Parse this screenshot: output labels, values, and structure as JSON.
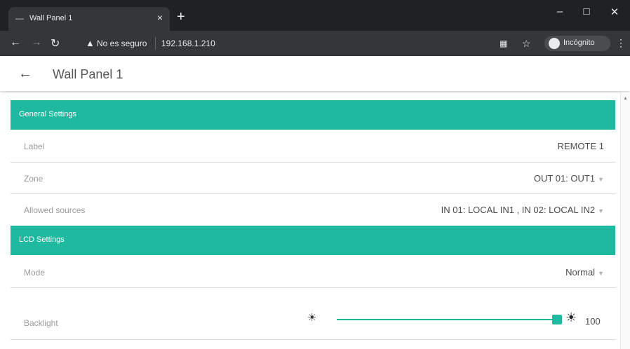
{
  "browser": {
    "tab_title": "Wall Panel 1",
    "security_warning": "No es seguro",
    "url": "192.168.1.210",
    "incognito_label": "Incógnito",
    "minimize": "–",
    "maximize": "□",
    "close": "✕"
  },
  "header": {
    "title": "Wall Panel 1"
  },
  "general": {
    "title": "General Settings",
    "rows": [
      {
        "label": "Label",
        "value": "REMOTE 1"
      },
      {
        "label": "Zone",
        "value": "OUT 01: OUT1"
      },
      {
        "label": "Allowed sources",
        "value": "IN 01: LOCAL IN1 , IN 02: LOCAL IN2"
      }
    ]
  },
  "lcd": {
    "title": "LCD Settings",
    "mode": {
      "label": "Mode",
      "value": "Normal"
    },
    "backlight": {
      "label": "Backlight",
      "value": "100"
    }
  },
  "colors": {
    "accent": "#1eb99f",
    "chrome_dark": "#202124",
    "chrome_toolbar": "#35363a"
  },
  "icons": {
    "back": "arrow-left-icon",
    "sun_small": "brightness-low-icon",
    "sun_large": "brightness-high-icon",
    "dropdown": "caret-down-icon"
  }
}
